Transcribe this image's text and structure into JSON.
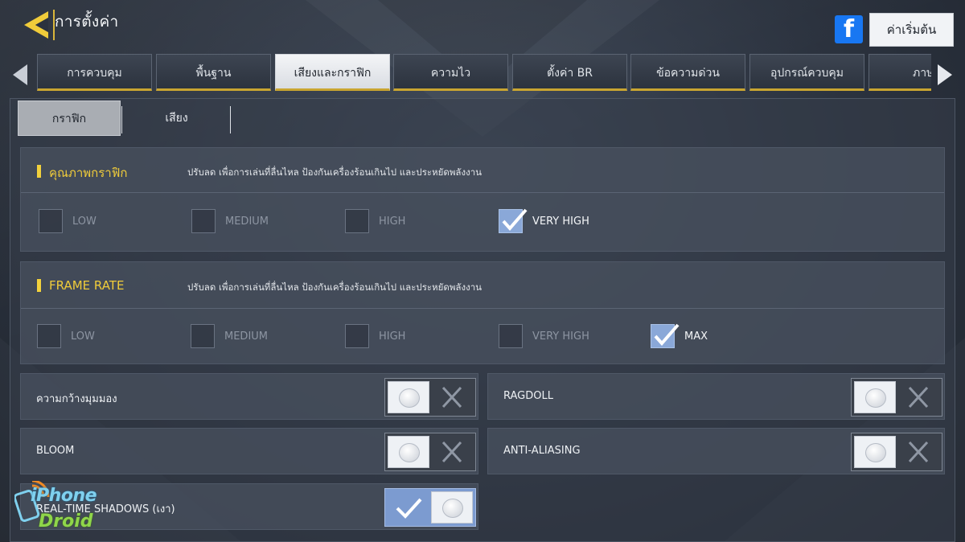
{
  "header": {
    "title": "การตั้งค่า",
    "facebook_glyph": "f",
    "reset_label": "ค่าเริ่มต้น"
  },
  "tabs": [
    {
      "label": "การควบคุม",
      "active": false
    },
    {
      "label": "พื้นฐาน",
      "active": false
    },
    {
      "label": "เสียงและกราฟิก",
      "active": true
    },
    {
      "label": "ความไว",
      "active": false
    },
    {
      "label": "ตั้งค่า BR",
      "active": false
    },
    {
      "label": "ข้อความด่วน",
      "active": false
    },
    {
      "label": "อุปกรณ์ควบคุม",
      "active": false
    },
    {
      "label": "ภาษ",
      "active": false
    }
  ],
  "subtabs": {
    "graphics": "กราฟิก",
    "audio": "เสียง"
  },
  "graphics_quality": {
    "title": "คุณภาพกราฟิก",
    "description": "ปรับลด เพื่อการเล่นที่ลื่นไหล ป้องกันเครื่องร้อนเกินไป และประหยัดพลังงาน",
    "options": [
      {
        "label": "LOW",
        "checked": false
      },
      {
        "label": "MEDIUM",
        "checked": false
      },
      {
        "label": "HIGH",
        "checked": false
      },
      {
        "label": "VERY HIGH",
        "checked": true
      }
    ]
  },
  "frame_rate": {
    "title": "FRAME RATE",
    "description": "ปรับลด เพื่อการเล่นที่ลื่นไหล ป้องกันเครื่องร้อนเกินไป และประหยัดพลังงาน",
    "options": [
      {
        "label": "LOW",
        "checked": false
      },
      {
        "label": "MEDIUM",
        "checked": false
      },
      {
        "label": "HIGH",
        "checked": false
      },
      {
        "label": "VERY HIGH",
        "checked": false
      },
      {
        "label": "MAX",
        "checked": true
      }
    ]
  },
  "toggles": {
    "fov": {
      "label": "ความกว้างมุมมอง",
      "on": false
    },
    "ragdoll": {
      "label": "RAGDOLL",
      "on": false
    },
    "bloom": {
      "label": "BLOOM",
      "on": false
    },
    "anti_aliasing": {
      "label": "ANTI-ALIASING",
      "on": false
    },
    "shadows": {
      "label": "REAL-TIME SHADOWS (เงา)",
      "on": true
    }
  },
  "watermark": {
    "line1": "iPhone",
    "line2": "Droid"
  },
  "colors": {
    "accent_yellow": "#f2d13c",
    "checkbox_checked": "#8aa8d8",
    "facebook_blue": "#1877f2"
  }
}
